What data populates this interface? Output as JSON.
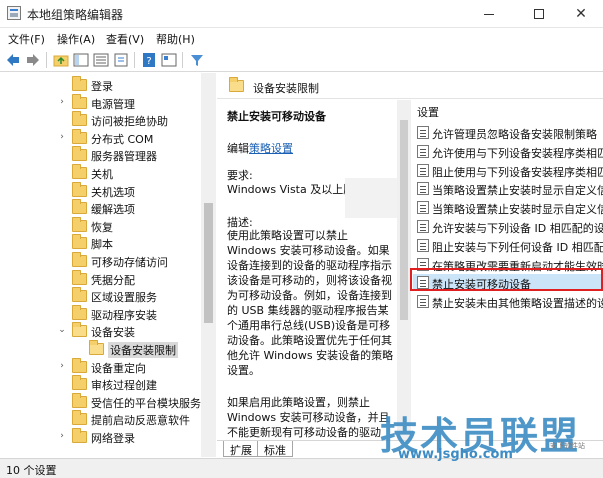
{
  "window": {
    "title": "本地组策略编辑器"
  },
  "menu": [
    "文件(F)",
    "操作(A)",
    "查看(V)",
    "帮助(H)"
  ],
  "tree": {
    "items": [
      {
        "label": "登录",
        "arrow": ""
      },
      {
        "label": "电源管理",
        "arrow": "›"
      },
      {
        "label": "访问被拒绝协助",
        "arrow": ""
      },
      {
        "label": "分布式 COM",
        "arrow": "›"
      },
      {
        "label": "服务器管理器",
        "arrow": ""
      },
      {
        "label": "关机",
        "arrow": ""
      },
      {
        "label": "关机选项",
        "arrow": ""
      },
      {
        "label": "缓解选项",
        "arrow": ""
      },
      {
        "label": "恢复",
        "arrow": ""
      },
      {
        "label": "脚本",
        "arrow": ""
      },
      {
        "label": "可移动存储访问",
        "arrow": ""
      },
      {
        "label": "凭据分配",
        "arrow": ""
      },
      {
        "label": "区域设置服务",
        "arrow": ""
      },
      {
        "label": "驱动程序安装",
        "arrow": ""
      },
      {
        "label": "设备安装",
        "arrow": "⌄"
      },
      {
        "label": "设备安装限制",
        "arrow": ""
      },
      {
        "label": "设备重定向",
        "arrow": "›"
      },
      {
        "label": "审核过程创建",
        "arrow": ""
      },
      {
        "label": "受信任的平台模块服务",
        "arrow": ""
      },
      {
        "label": "提前启动反恶意软件",
        "arrow": ""
      },
      {
        "label": "网络登录",
        "arrow": "›"
      }
    ]
  },
  "right": {
    "header_title": "设备安装限制",
    "description": {
      "title": "禁止安装可移动设备",
      "edit_prefix": "编辑",
      "edit_link": "策略设置",
      "requirements_label": "要求:",
      "requirements_value": "Windows Vista 及以上版本",
      "desc_label": "描述:",
      "body": "使用此策略设置可以禁止 Windows 安装可移动设备。如果设备连接到的设备的驱动程序指示该设备是可移动的，则将该设备视为可移动设备。例如，设备连接到的 USB 集线器的驱动程序报告某个通用串行总线(USB)设备是可移动设备。此策略设置优先于任何其他允许 Windows 安装设备的策略设置。",
      "body2": "如果启用此策略设置，则禁止 Windows 安装可移动设备，并且不能更新现有可移动设备的驱动"
    },
    "list_header": "设置",
    "settings": [
      "允许管理员忽略设备安装限制策略",
      "允许使用与下列设备安装程序类相匹配",
      "阻止使用与下列设备安装程序类相匹配",
      "当策略设置禁止安装时显示自定义信息",
      "当策略设置禁止安装时显示自定义信息",
      "允许安装与下列设备 ID 相匹配的设备",
      "阻止安装与下列任何设备 ID 相匹配的设备",
      "在策略更改需要重新启动才能生效时",
      "禁止安装可移动设备",
      "禁止安装未由其他策略设置描述的设备"
    ],
    "selected_index": 8
  },
  "tabs": [
    "扩展",
    "标准"
  ],
  "status": "10 个设置",
  "watermark": {
    "brand": "技术员联盟",
    "url": "www.jsgho.com",
    "small": "安下软件站"
  },
  "colors": {
    "selection": "#cce4f7",
    "highlight_border": "#e02020",
    "link": "#1a5fb4",
    "watermark": "#3d8cc4"
  }
}
